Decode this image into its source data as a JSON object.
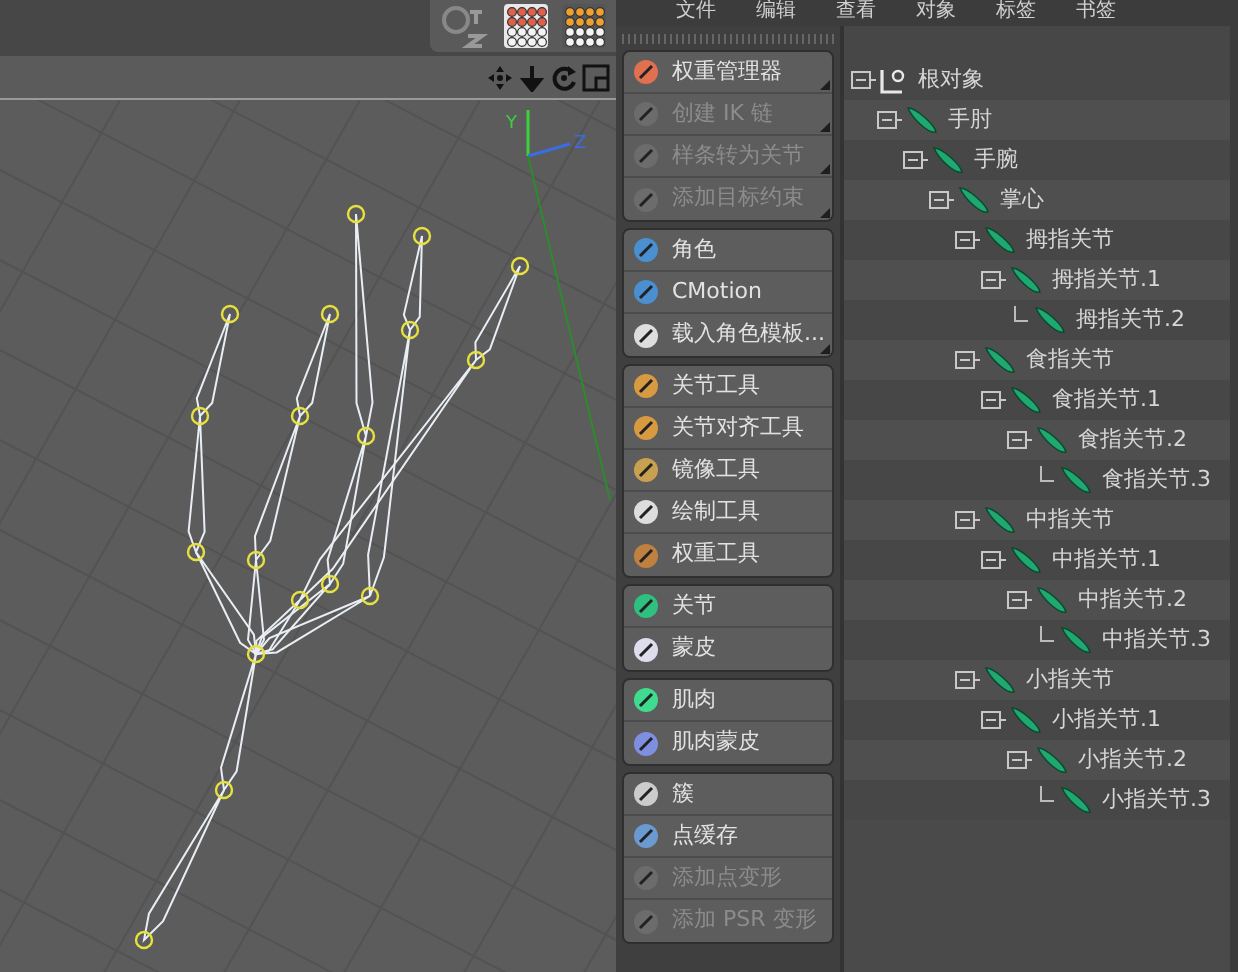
{
  "menu": [
    {
      "label": "文件"
    },
    {
      "label": "编辑"
    },
    {
      "label": "查看"
    },
    {
      "label": "对象"
    },
    {
      "label": "标签"
    },
    {
      "label": "书签"
    }
  ],
  "tool_groups": [
    {
      "buttons": [
        {
          "label": "权重管理器",
          "disabled": false,
          "submenu": true
        },
        {
          "label": "创建 IK 链",
          "disabled": true,
          "submenu": true
        },
        {
          "label": "样条转为关节",
          "disabled": true,
          "submenu": true
        },
        {
          "label": "添加目标约束",
          "disabled": true,
          "submenu": true
        }
      ]
    },
    {
      "buttons": [
        {
          "label": "角色",
          "disabled": false,
          "submenu": false
        },
        {
          "label": "CMotion",
          "disabled": false,
          "submenu": false
        },
        {
          "label": "载入角色模板...",
          "disabled": false,
          "submenu": true
        }
      ]
    },
    {
      "buttons": [
        {
          "label": "关节工具",
          "disabled": false,
          "submenu": false
        },
        {
          "label": "关节对齐工具",
          "disabled": false,
          "submenu": false
        },
        {
          "label": "镜像工具",
          "disabled": false,
          "submenu": false
        },
        {
          "label": "绘制工具",
          "disabled": false,
          "submenu": false
        },
        {
          "label": "权重工具",
          "disabled": false,
          "submenu": false
        }
      ]
    },
    {
      "buttons": [
        {
          "label": "关节",
          "disabled": false,
          "submenu": false
        },
        {
          "label": "蒙皮",
          "disabled": false,
          "submenu": false
        }
      ]
    },
    {
      "buttons": [
        {
          "label": "肌肉",
          "disabled": false,
          "submenu": false
        },
        {
          "label": "肌肉蒙皮",
          "disabled": false,
          "submenu": false
        }
      ]
    },
    {
      "buttons": [
        {
          "label": "簇",
          "disabled": false,
          "submenu": false
        },
        {
          "label": "点缓存",
          "disabled": false,
          "submenu": false
        },
        {
          "label": "添加点变形",
          "disabled": true,
          "submenu": false
        },
        {
          "label": "添加 PSR 变形",
          "disabled": true,
          "submenu": false
        }
      ]
    }
  ],
  "object_tree": [
    {
      "label": "根对象",
      "kind": "null",
      "expanded": true,
      "children": [
        {
          "label": "手肘",
          "kind": "joint",
          "expanded": true,
          "children": [
            {
              "label": "手腕",
              "kind": "joint",
              "expanded": true,
              "children": [
                {
                  "label": "掌心",
                  "kind": "joint",
                  "expanded": true,
                  "children": [
                    {
                      "label": "拇指关节",
                      "kind": "joint",
                      "expanded": true,
                      "children": [
                        {
                          "label": "拇指关节.1",
                          "kind": "joint",
                          "expanded": true,
                          "children": [
                            {
                              "label": "拇指关节.2",
                              "kind": "joint",
                              "expanded": false
                            }
                          ]
                        }
                      ]
                    },
                    {
                      "label": "食指关节",
                      "kind": "joint",
                      "expanded": true,
                      "children": [
                        {
                          "label": "食指关节.1",
                          "kind": "joint",
                          "expanded": true,
                          "children": [
                            {
                              "label": "食指关节.2",
                              "kind": "joint",
                              "expanded": true,
                              "children": [
                                {
                                  "label": "食指关节.3",
                                  "kind": "joint",
                                  "expanded": false
                                }
                              ]
                            }
                          ]
                        }
                      ]
                    },
                    {
                      "label": "中指关节",
                      "kind": "joint",
                      "expanded": true,
                      "children": [
                        {
                          "label": "中指关节.1",
                          "kind": "joint",
                          "expanded": true,
                          "children": [
                            {
                              "label": "中指关节.2",
                              "kind": "joint",
                              "expanded": true,
                              "children": [
                                {
                                  "label": "中指关节.3",
                                  "kind": "joint",
                                  "expanded": false
                                }
                              ]
                            }
                          ]
                        }
                      ]
                    },
                    {
                      "label": "小指关节",
                      "kind": "joint",
                      "expanded": true,
                      "children": [
                        {
                          "label": "小指关节.1",
                          "kind": "joint",
                          "expanded": true,
                          "children": [
                            {
                              "label": "小指关节.2",
                              "kind": "joint",
                              "expanded": true,
                              "children": [
                                {
                                  "label": "小指关节.3",
                                  "kind": "joint",
                                  "expanded": false
                                }
                              ]
                            }
                          ]
                        }
                      ]
                    }
                  ]
                }
              ]
            }
          ]
        }
      ]
    }
  ],
  "viewport": {
    "axis_labels": [
      {
        "label": "Y"
      },
      {
        "label": "Z"
      }
    ]
  }
}
